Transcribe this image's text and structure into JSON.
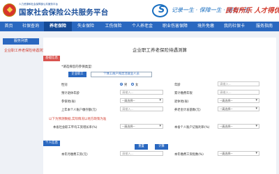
{
  "header": {
    "org": "人力资源和社会保障部公共服务平台",
    "title": "国家社会保险公共服务平台",
    "logo_char": "S",
    "slogan": "记录一生 · 保障一生 · 服务一生",
    "deco_text": "民有所乐 人才得优"
  },
  "nav": {
    "items": [
      "首页",
      "社保查询",
      "养老保险",
      "失业保险",
      "工伤保险",
      "个人养老金",
      "职业伤害保障",
      "境外免缴",
      "我的社保卡",
      "服务指南"
    ],
    "active": "养老保险"
  },
  "sidebar": {
    "header": "服务列表",
    "link": "企业职工养老保险待遇测算"
  },
  "form": {
    "page_title": "企业职工养老保险待遇测算",
    "section_basic": "基础信息",
    "choose_hint": "*请选择您的参保类型:",
    "type_btn_active": "企业职工",
    "type_btn_other": "个体工商户和灵活就业人员",
    "gender_label": "性别",
    "gender_male": "男",
    "gender_female": "女",
    "age_label": "年龄",
    "age_placeholder": "请输入...",
    "retire_age_label": "预计退休年龄",
    "retire_age_placeholder": "请输入...",
    "paid_years_label": "累计缴费年限",
    "paid_years_placeholder": "请输入...",
    "insured_place_label": "参保地(省)",
    "insured_place_value": "--请选择--",
    "retire_place_label": "退休地(省)",
    "retire_place_value": "--请选择--",
    "last_year_label": "上年本个人账户缴存额(元)",
    "last_year_placeholder": "请输入...",
    "index_label": "养老金计发基数(元)",
    "index_value": "--请选择--",
    "note": "以下为预测数据,实际情况以地方政策为准",
    "wage_growth_label": "本省社会职工平均工资增长率(%)",
    "wage_growth_value": "--请选择--",
    "account_rate_label": "本省个人账户记账利率(%)",
    "account_rate_value": "--请选择--",
    "section_personal": "个人信息",
    "salary_label": "本年月缴费工资(元)",
    "salary_placeholder": "请输入...",
    "salary_index_label": "本年缴费工资指数(%)",
    "salary_index_value": "--请选择--",
    "reset_btn": "重置",
    "calc_btn": "计算"
  }
}
